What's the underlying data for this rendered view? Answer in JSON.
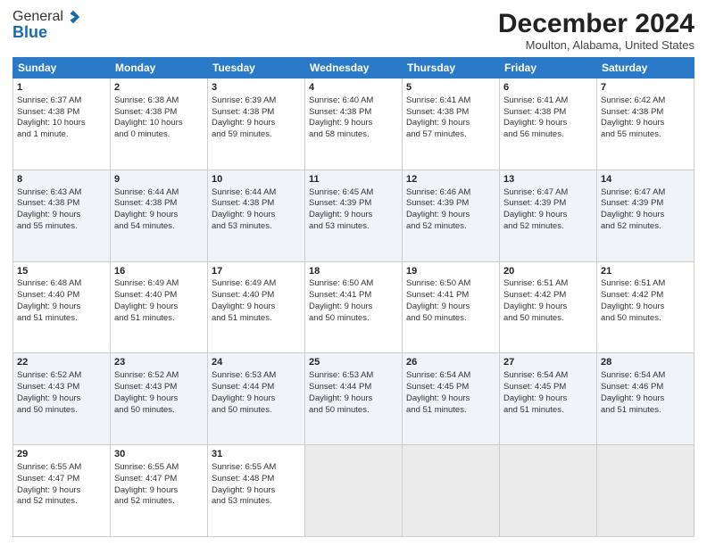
{
  "header": {
    "logo_general": "General",
    "logo_blue": "Blue",
    "month_title": "December 2024",
    "location": "Moulton, Alabama, United States"
  },
  "weekdays": [
    "Sunday",
    "Monday",
    "Tuesday",
    "Wednesday",
    "Thursday",
    "Friday",
    "Saturday"
  ],
  "weeks": [
    [
      {
        "day": "1",
        "lines": [
          "Sunrise: 6:37 AM",
          "Sunset: 4:38 PM",
          "Daylight: 10 hours",
          "and 1 minute."
        ]
      },
      {
        "day": "2",
        "lines": [
          "Sunrise: 6:38 AM",
          "Sunset: 4:38 PM",
          "Daylight: 10 hours",
          "and 0 minutes."
        ]
      },
      {
        "day": "3",
        "lines": [
          "Sunrise: 6:39 AM",
          "Sunset: 4:38 PM",
          "Daylight: 9 hours",
          "and 59 minutes."
        ]
      },
      {
        "day": "4",
        "lines": [
          "Sunrise: 6:40 AM",
          "Sunset: 4:38 PM",
          "Daylight: 9 hours",
          "and 58 minutes."
        ]
      },
      {
        "day": "5",
        "lines": [
          "Sunrise: 6:41 AM",
          "Sunset: 4:38 PM",
          "Daylight: 9 hours",
          "and 57 minutes."
        ]
      },
      {
        "day": "6",
        "lines": [
          "Sunrise: 6:41 AM",
          "Sunset: 4:38 PM",
          "Daylight: 9 hours",
          "and 56 minutes."
        ]
      },
      {
        "day": "7",
        "lines": [
          "Sunrise: 6:42 AM",
          "Sunset: 4:38 PM",
          "Daylight: 9 hours",
          "and 55 minutes."
        ]
      }
    ],
    [
      {
        "day": "8",
        "lines": [
          "Sunrise: 6:43 AM",
          "Sunset: 4:38 PM",
          "Daylight: 9 hours",
          "and 55 minutes."
        ]
      },
      {
        "day": "9",
        "lines": [
          "Sunrise: 6:44 AM",
          "Sunset: 4:38 PM",
          "Daylight: 9 hours",
          "and 54 minutes."
        ]
      },
      {
        "day": "10",
        "lines": [
          "Sunrise: 6:44 AM",
          "Sunset: 4:38 PM",
          "Daylight: 9 hours",
          "and 53 minutes."
        ]
      },
      {
        "day": "11",
        "lines": [
          "Sunrise: 6:45 AM",
          "Sunset: 4:39 PM",
          "Daylight: 9 hours",
          "and 53 minutes."
        ]
      },
      {
        "day": "12",
        "lines": [
          "Sunrise: 6:46 AM",
          "Sunset: 4:39 PM",
          "Daylight: 9 hours",
          "and 52 minutes."
        ]
      },
      {
        "day": "13",
        "lines": [
          "Sunrise: 6:47 AM",
          "Sunset: 4:39 PM",
          "Daylight: 9 hours",
          "and 52 minutes."
        ]
      },
      {
        "day": "14",
        "lines": [
          "Sunrise: 6:47 AM",
          "Sunset: 4:39 PM",
          "Daylight: 9 hours",
          "and 52 minutes."
        ]
      }
    ],
    [
      {
        "day": "15",
        "lines": [
          "Sunrise: 6:48 AM",
          "Sunset: 4:40 PM",
          "Daylight: 9 hours",
          "and 51 minutes."
        ]
      },
      {
        "day": "16",
        "lines": [
          "Sunrise: 6:49 AM",
          "Sunset: 4:40 PM",
          "Daylight: 9 hours",
          "and 51 minutes."
        ]
      },
      {
        "day": "17",
        "lines": [
          "Sunrise: 6:49 AM",
          "Sunset: 4:40 PM",
          "Daylight: 9 hours",
          "and 51 minutes."
        ]
      },
      {
        "day": "18",
        "lines": [
          "Sunrise: 6:50 AM",
          "Sunset: 4:41 PM",
          "Daylight: 9 hours",
          "and 50 minutes."
        ]
      },
      {
        "day": "19",
        "lines": [
          "Sunrise: 6:50 AM",
          "Sunset: 4:41 PM",
          "Daylight: 9 hours",
          "and 50 minutes."
        ]
      },
      {
        "day": "20",
        "lines": [
          "Sunrise: 6:51 AM",
          "Sunset: 4:42 PM",
          "Daylight: 9 hours",
          "and 50 minutes."
        ]
      },
      {
        "day": "21",
        "lines": [
          "Sunrise: 6:51 AM",
          "Sunset: 4:42 PM",
          "Daylight: 9 hours",
          "and 50 minutes."
        ]
      }
    ],
    [
      {
        "day": "22",
        "lines": [
          "Sunrise: 6:52 AM",
          "Sunset: 4:43 PM",
          "Daylight: 9 hours",
          "and 50 minutes."
        ]
      },
      {
        "day": "23",
        "lines": [
          "Sunrise: 6:52 AM",
          "Sunset: 4:43 PM",
          "Daylight: 9 hours",
          "and 50 minutes."
        ]
      },
      {
        "day": "24",
        "lines": [
          "Sunrise: 6:53 AM",
          "Sunset: 4:44 PM",
          "Daylight: 9 hours",
          "and 50 minutes."
        ]
      },
      {
        "day": "25",
        "lines": [
          "Sunrise: 6:53 AM",
          "Sunset: 4:44 PM",
          "Daylight: 9 hours",
          "and 50 minutes."
        ]
      },
      {
        "day": "26",
        "lines": [
          "Sunrise: 6:54 AM",
          "Sunset: 4:45 PM",
          "Daylight: 9 hours",
          "and 51 minutes."
        ]
      },
      {
        "day": "27",
        "lines": [
          "Sunrise: 6:54 AM",
          "Sunset: 4:45 PM",
          "Daylight: 9 hours",
          "and 51 minutes."
        ]
      },
      {
        "day": "28",
        "lines": [
          "Sunrise: 6:54 AM",
          "Sunset: 4:46 PM",
          "Daylight: 9 hours",
          "and 51 minutes."
        ]
      }
    ],
    [
      {
        "day": "29",
        "lines": [
          "Sunrise: 6:55 AM",
          "Sunset: 4:47 PM",
          "Daylight: 9 hours",
          "and 52 minutes."
        ]
      },
      {
        "day": "30",
        "lines": [
          "Sunrise: 6:55 AM",
          "Sunset: 4:47 PM",
          "Daylight: 9 hours",
          "and 52 minutes."
        ]
      },
      {
        "day": "31",
        "lines": [
          "Sunrise: 6:55 AM",
          "Sunset: 4:48 PM",
          "Daylight: 9 hours",
          "and 53 minutes."
        ]
      },
      null,
      null,
      null,
      null
    ]
  ]
}
